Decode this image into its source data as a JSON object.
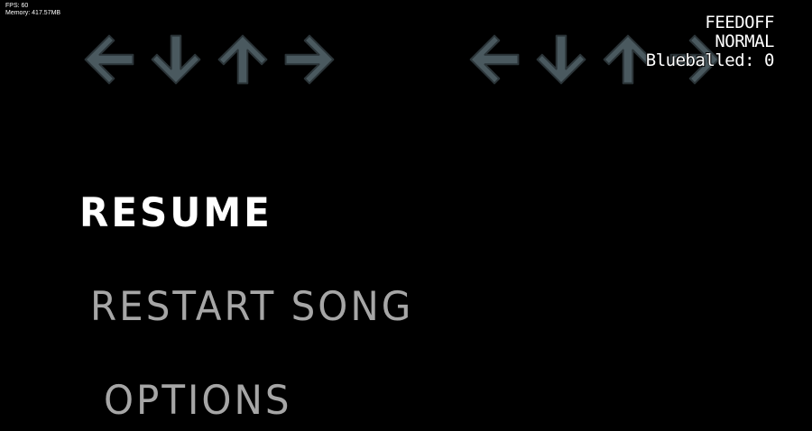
{
  "debug": {
    "fps": "FPS: 60",
    "memory": "Memory: 417.57MB"
  },
  "strums": {
    "opponent": [
      "left-arrow-icon",
      "down-arrow-icon",
      "up-arrow-icon",
      "right-arrow-icon"
    ],
    "player": [
      "left-arrow-icon",
      "down-arrow-icon",
      "up-arrow-icon",
      "right-arrow-icon"
    ],
    "arrow_color": "#87a3ad"
  },
  "song_info": {
    "title": "FEEDOFF",
    "difficulty": "NORMAL",
    "blueballed": "Blueballed: 0"
  },
  "pause_menu": {
    "items": [
      {
        "label": "RESUME",
        "selected": true
      },
      {
        "label": "RESTART SONG",
        "selected": false
      },
      {
        "label": "OPTIONS",
        "selected": false
      }
    ],
    "selected_color": "#ffffff",
    "unselected_color": "#a6a6a6"
  }
}
